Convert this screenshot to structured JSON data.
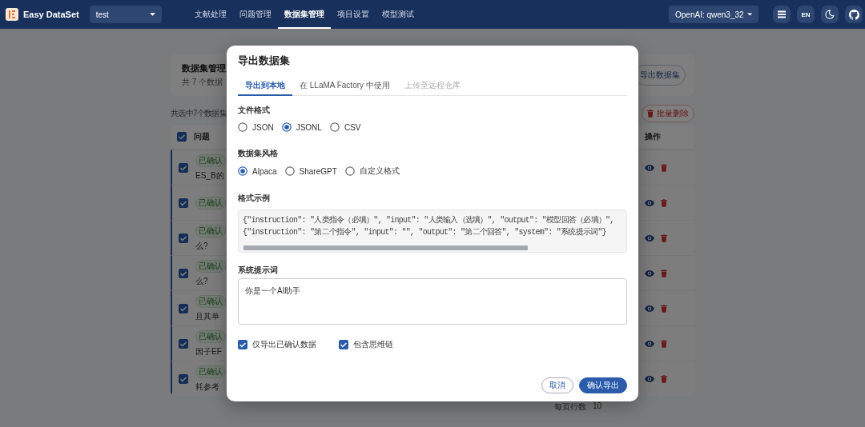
{
  "navbar": {
    "app_name": "Easy DataSet",
    "project": "test",
    "nav": [
      {
        "label": "文献处理",
        "selected": false
      },
      {
        "label": "问题管理",
        "selected": false
      },
      {
        "label": "数据集管理",
        "selected": true
      },
      {
        "label": "项目设置",
        "selected": false
      },
      {
        "label": "模型测试",
        "selected": false
      }
    ],
    "model": "OpenAI: qwen3_32",
    "language": "EN"
  },
  "page": {
    "title": "数据集管理",
    "subtitle": "共 7 个数据",
    "export_button": "导出数据集",
    "selection_info": "共选中7个数据集",
    "bulk_delete": "批量删除",
    "table": {
      "select_all": true,
      "columns": [
        "问题",
        "操作"
      ],
      "rows": [
        {
          "selected": true,
          "tag": "已确认",
          "text": "ES_B的"
        },
        {
          "selected": true,
          "tag": "已确认"
        },
        {
          "selected": true,
          "tag": "已确认",
          "text": "么?"
        },
        {
          "selected": true,
          "tag": "已确认",
          "text": "么?"
        },
        {
          "selected": true,
          "tag": "已确认",
          "text": "且其单"
        },
        {
          "selected": true,
          "tag": "已确认",
          "text": "因子EF"
        },
        {
          "selected": true,
          "tag": "已确认",
          "text": "耗参考"
        }
      ]
    },
    "pagination": {
      "rows_per_page_label": "每页行数",
      "rows_per_page": "10"
    }
  },
  "dialog": {
    "title": "导出数据集",
    "tabs": [
      {
        "label": "导出到本地",
        "selected": true,
        "disabled": false
      },
      {
        "label": "在 LLaMA Factory 中使用",
        "selected": false,
        "disabled": false
      },
      {
        "label": "上传至远程仓库",
        "selected": false,
        "disabled": true
      }
    ],
    "file_format": {
      "label": "文件格式",
      "options": [
        {
          "label": "JSON",
          "selected": false
        },
        {
          "label": "JSONL",
          "selected": true
        },
        {
          "label": "CSV",
          "selected": false
        }
      ]
    },
    "dataset_style": {
      "label": "数据集风格",
      "options": [
        {
          "label": "Alpaca",
          "selected": true
        },
        {
          "label": "ShareGPT",
          "selected": false
        },
        {
          "label": "自定义格式",
          "selected": false
        }
      ]
    },
    "example": {
      "label": "格式示例",
      "lines": [
        "{\"instruction\": \"人类指令（必填）\", \"input\": \"人类输入（选填）\", \"output\": \"模型回答（必填）\",",
        "{\"instruction\": \"第二个指令\", \"input\": \"\", \"output\": \"第二个回答\", \"system\": \"系统提示词\"}"
      ]
    },
    "system_prompt": {
      "label": "系统提示词",
      "value": "你是一个AI助手"
    },
    "options": [
      {
        "label": "仅导出已确认数据",
        "checked": true
      },
      {
        "label": "包含思维链",
        "checked": true
      }
    ],
    "buttons": [
      {
        "label": "取消",
        "kind": "outlined"
      },
      {
        "label": "确认导出",
        "kind": "primary"
      }
    ]
  }
}
